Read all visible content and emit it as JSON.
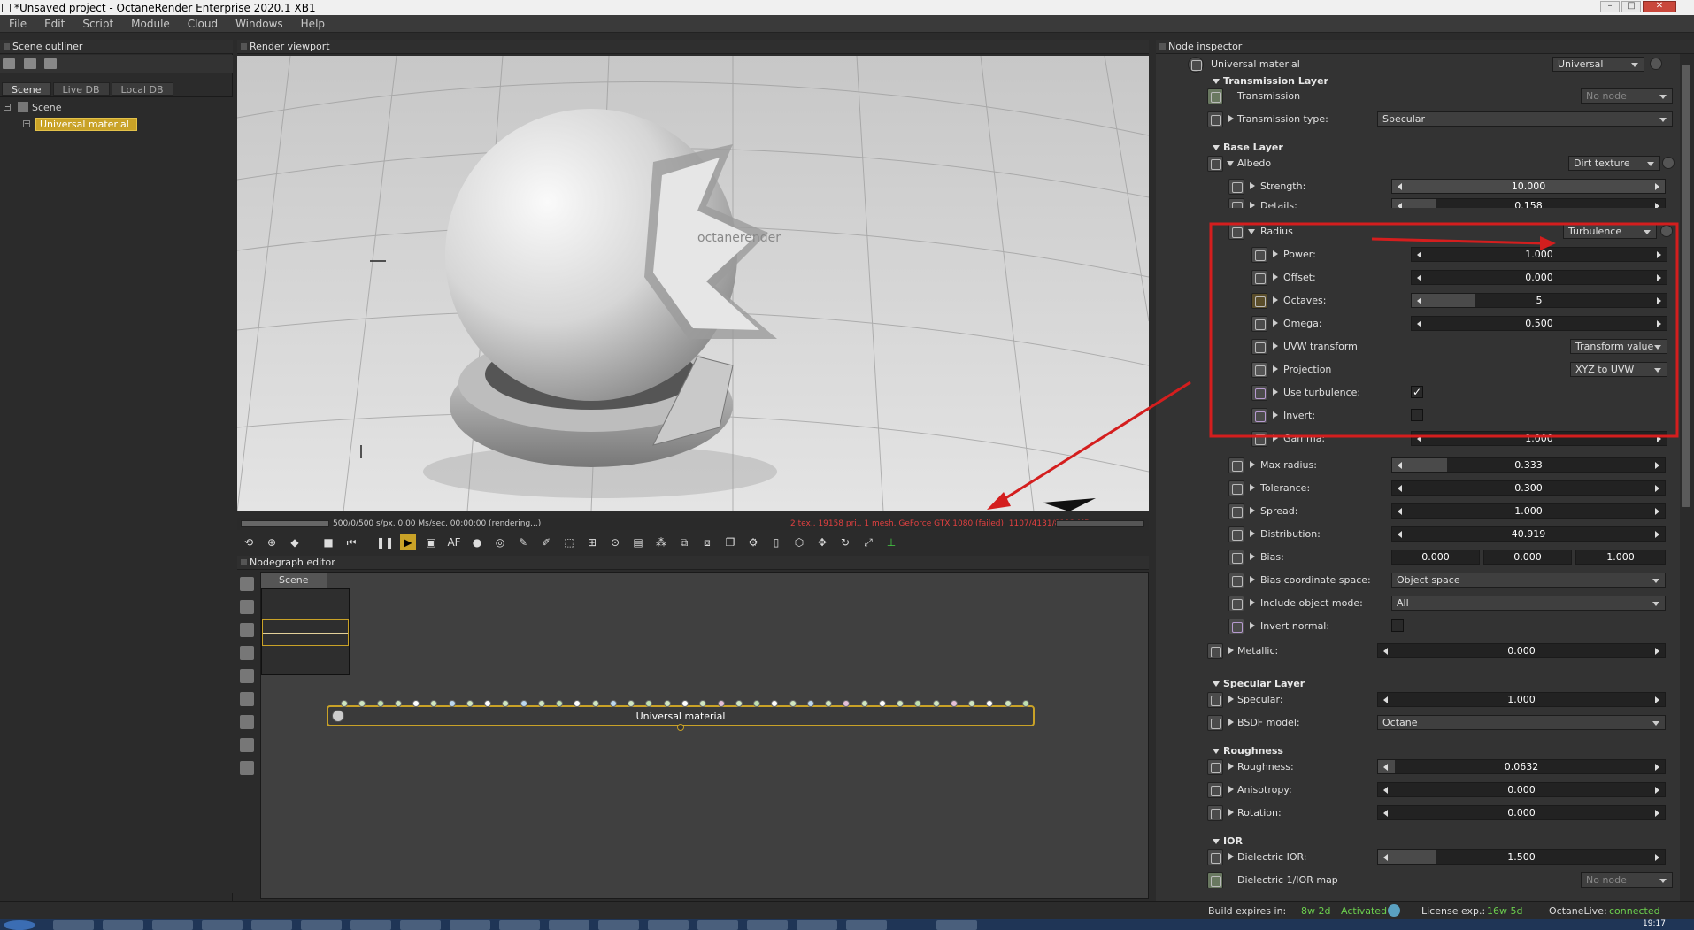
{
  "window": {
    "title": "*Unsaved project - OctaneRender Enterprise 2020.1 XB1",
    "minimize": "–",
    "maximize": "□",
    "close": "✕"
  },
  "menu": [
    "File",
    "Edit",
    "Script",
    "Module",
    "Cloud",
    "Windows",
    "Help"
  ],
  "outliner": {
    "title": "Scene outliner",
    "tabs": [
      "Scene",
      "Live DB",
      "Local DB"
    ],
    "tree": {
      "root": "Scene",
      "child": "Universal material"
    }
  },
  "viewport": {
    "title": "Render viewport",
    "status_left": "500/0/500 s/px, 0.00 Ms/sec, 00:00:00 (rendering...)",
    "status_right": "2 tex., 19158 pri., 1 mesh, GeForce GTX 1080 (failed), 1107/4131/8192 MB",
    "logo_text": "octanerender"
  },
  "nodegraph": {
    "title": "Nodegraph editor",
    "tab": "Scene",
    "node_label": "Universal material"
  },
  "inspector": {
    "title": "Node inspector",
    "node_name": "Universal material",
    "node_type": "Universal",
    "sections": {
      "transmission_layer": "Transmission Layer",
      "base_layer": "Base Layer",
      "specular_layer": "Specular Layer",
      "roughness": "Roughness",
      "ior": "IOR"
    },
    "rows": {
      "transmission": {
        "label": "Transmission",
        "value": "No node"
      },
      "transmission_type": {
        "label": "Transmission type:",
        "value": "Specular"
      },
      "albedo": {
        "label": "Albedo",
        "value": "Dirt texture"
      },
      "strength": {
        "label": "Strength:",
        "value": "10.000",
        "fill": 1.0
      },
      "details": {
        "label": "Details:",
        "value": "0.158",
        "fill": 0.16
      },
      "radius": {
        "label": "Radius",
        "value": "Turbulence"
      },
      "power": {
        "label": "Power:",
        "value": "1.000",
        "fill": 0.0
      },
      "offset": {
        "label": "Offset:",
        "value": "0.000",
        "fill": 0.0
      },
      "octaves": {
        "label": "Octaves:",
        "value": "5",
        "fill": 0.25
      },
      "omega": {
        "label": "Omega:",
        "value": "0.500",
        "fill": 0.0
      },
      "uvw_transform": {
        "label": "UVW transform",
        "value": "Transform value"
      },
      "projection": {
        "label": "Projection",
        "value": "XYZ to UVW"
      },
      "use_turbulence": {
        "label": "Use turbulence:",
        "mark": "✓"
      },
      "invert": {
        "label": "Invert:",
        "mark": ""
      },
      "gamma": {
        "label": "Gamma:",
        "value": "1.000",
        "fill": 0.0
      },
      "max_radius": {
        "label": "Max radius:",
        "value": "0.333",
        "fill": 0.2
      },
      "tolerance": {
        "label": "Tolerance:",
        "value": "0.300",
        "fill": 0.0
      },
      "spread": {
        "label": "Spread:",
        "value": "1.000",
        "fill": 0.0
      },
      "distribution": {
        "label": "Distribution:",
        "value": "40.919",
        "fill": 0.0
      },
      "bias": {
        "label": "Bias:",
        "values": [
          "0.000",
          "0.000",
          "1.000"
        ]
      },
      "bias_coordinate_space": {
        "label": "Bias coordinate space:",
        "value": "Object space"
      },
      "include_object_mode": {
        "label": "Include object mode:",
        "value": "All"
      },
      "invert_normal": {
        "label": "Invert normal:",
        "mark": ""
      },
      "metallic": {
        "label": "Metallic:",
        "value": "0.000",
        "fill": 0.0
      },
      "specular": {
        "label": "Specular:",
        "value": "1.000",
        "fill": 0.0
      },
      "bsdf_model": {
        "label": "BSDF model:",
        "value": "Octane"
      },
      "roughness": {
        "label": "Roughness:",
        "value": "0.0632",
        "fill": 0.06
      },
      "anisotropy": {
        "label": "Anisotropy:",
        "value": "0.000",
        "fill": 0.0
      },
      "rotation": {
        "label": "Rotation:",
        "value": "0.000",
        "fill": 0.0
      },
      "dielectric_ior": {
        "label": "Dielectric IOR:",
        "value": "1.500",
        "fill": 0.2
      },
      "dielectric_ior_map": {
        "label": "Dielectric 1/IOR map",
        "value": "No node"
      }
    }
  },
  "statusbar": {
    "build_label": "Build expires in:",
    "build_value": "8w 2d",
    "activated": "Activated",
    "license_label": "License exp.:",
    "license_value": "16w 5d",
    "live_label": "OctaneLive:",
    "live_value": "connected",
    "clock": "19:17"
  },
  "colors": {
    "accent": "#c9a227",
    "annotation": "#d41e1e",
    "active_green": "#6ccf4e"
  }
}
